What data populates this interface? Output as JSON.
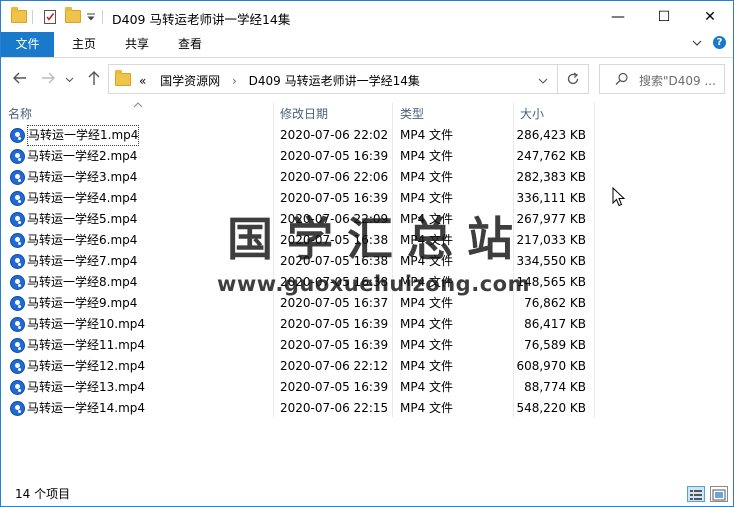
{
  "window": {
    "title": "D409 马转运老师讲一学经14集",
    "minimize": "—",
    "maximize": "☐",
    "close": "✕"
  },
  "ribbon": {
    "tabs": [
      "文件",
      "主页",
      "共享",
      "查看"
    ]
  },
  "address": {
    "overflow": "«",
    "crumbs": [
      "国学资源网",
      "D409 马转运老师讲一学经14集"
    ],
    "separator": "›"
  },
  "search": {
    "placeholder": "搜索\"D409 ..."
  },
  "columns": {
    "name": "名称",
    "date": "修改日期",
    "type": "类型",
    "size": "大小"
  },
  "files": [
    {
      "name": "马转运一学经1.mp4",
      "date": "2020-07-06 22:02",
      "type": "MP4 文件",
      "size": "286,423 KB"
    },
    {
      "name": "马转运一学经2.mp4",
      "date": "2020-07-05 16:39",
      "type": "MP4 文件",
      "size": "247,762 KB"
    },
    {
      "name": "马转运一学经3.mp4",
      "date": "2020-07-06 22:06",
      "type": "MP4 文件",
      "size": "282,383 KB"
    },
    {
      "name": "马转运一学经4.mp4",
      "date": "2020-07-05 16:39",
      "type": "MP4 文件",
      "size": "336,111 KB"
    },
    {
      "name": "马转运一学经5.mp4",
      "date": "2020-07-06 22:09",
      "type": "MP4 文件",
      "size": "267,977 KB"
    },
    {
      "name": "马转运一学经6.mp4",
      "date": "2020-07-05 16:38",
      "type": "MP4 文件",
      "size": "217,033 KB"
    },
    {
      "name": "马转运一学经7.mp4",
      "date": "2020-07-05 16:38",
      "type": "MP4 文件",
      "size": "334,550 KB"
    },
    {
      "name": "马转运一学经8.mp4",
      "date": "2020-07-05 16:38",
      "type": "MP4 文件",
      "size": "148,565 KB"
    },
    {
      "name": "马转运一学经9.mp4",
      "date": "2020-07-05 16:37",
      "type": "MP4 文件",
      "size": "76,862 KB"
    },
    {
      "name": "马转运一学经10.mp4",
      "date": "2020-07-05 16:39",
      "type": "MP4 文件",
      "size": "86,417 KB"
    },
    {
      "name": "马转运一学经11.mp4",
      "date": "2020-07-05 16:39",
      "type": "MP4 文件",
      "size": "76,589 KB"
    },
    {
      "name": "马转运一学经12.mp4",
      "date": "2020-07-06 22:12",
      "type": "MP4 文件",
      "size": "608,970 KB"
    },
    {
      "name": "马转运一学经13.mp4",
      "date": "2020-07-05 16:39",
      "type": "MP4 文件",
      "size": "88,774 KB"
    },
    {
      "name": "马转运一学经14.mp4",
      "date": "2020-07-06 22:15",
      "type": "MP4 文件",
      "size": "548,220 KB"
    }
  ],
  "watermark": {
    "title": "国学汇总站",
    "url": "www.guoxuehuizong.com"
  },
  "status": {
    "count": "14 个项目"
  },
  "colors": {
    "accent": "#1979ca",
    "header_text": "#4c607a"
  }
}
